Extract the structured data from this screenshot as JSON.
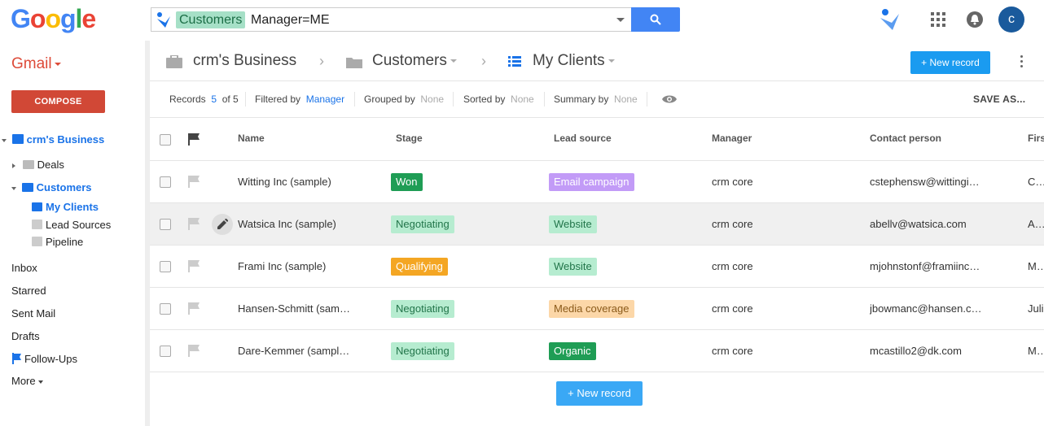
{
  "topbar": {
    "logo": [
      "G",
      "o",
      "o",
      "g",
      "l",
      "e"
    ],
    "logo_colors": [
      "#4285f4",
      "#ea4335",
      "#fbbc05",
      "#4285f4",
      "#34a853",
      "#ea4335"
    ],
    "search_chip": "Customers",
    "search_query": "Manager=ME",
    "avatar_letter": "c"
  },
  "leftnav": {
    "gmail": "Gmail",
    "compose": "COMPOSE",
    "business": "crm's Business",
    "deals": "Deals",
    "customers": "Customers",
    "my_clients": "My Clients",
    "lead_sources": "Lead Sources",
    "pipeline": "Pipeline",
    "inbox": "Inbox",
    "starred": "Starred",
    "sent": "Sent Mail",
    "drafts": "Drafts",
    "followups": "Follow-Ups",
    "more": "More"
  },
  "breadcrumb": {
    "business": "crm's Business",
    "customers": "Customers",
    "my_clients": "My Clients",
    "new_record": "+ New record"
  },
  "toolbar": {
    "records_label": "Records",
    "records_count": "5",
    "records_of": "of 5",
    "filtered_label": "Filtered by",
    "filtered_value": "Manager",
    "grouped_label": "Grouped by",
    "grouped_value": "None",
    "sorted_label": "Sorted by",
    "sorted_value": "None",
    "summary_label": "Summary by",
    "summary_value": "None",
    "save_as": "SAVE AS..."
  },
  "table": {
    "headers": {
      "name": "Name",
      "stage": "Stage",
      "lead_source": "Lead source",
      "manager": "Manager",
      "contact": "Contact person",
      "first": "Firs"
    },
    "rows": [
      {
        "name": "Witting Inc (sample)",
        "stage": "Won",
        "lead": "Email campaign",
        "manager": "crm core",
        "contact": "cstephensw@wittingi…",
        "first": "Chr"
      },
      {
        "name": "Watsica Inc (sample)",
        "stage": "Negotiating",
        "lead": "Website",
        "manager": "crm core",
        "contact": "abellv@watsica.com",
        "first": "Ada"
      },
      {
        "name": "Frami Inc (sample)",
        "stage": "Qualifying",
        "lead": "Website",
        "manager": "crm core",
        "contact": "mjohnstonf@framiinc…",
        "first": "Mic"
      },
      {
        "name": "Hansen-Schmitt (sam…",
        "stage": "Negotiating",
        "lead": "Media coverage",
        "manager": "crm core",
        "contact": "jbowmanc@hansen.c…",
        "first": "Juli"
      },
      {
        "name": "Dare-Kemmer (sampl…",
        "stage": "Negotiating",
        "lead": "Organic",
        "manager": "crm core",
        "contact": "mcastillo2@dk.com",
        "first": "Mar"
      }
    ],
    "new_record": "+ New record"
  },
  "colors": {
    "won": "#1f9d55",
    "negotiating_bg": "#b6ecd0",
    "negotiating_fg": "#22754a",
    "qualifying": "#f4a623",
    "email_campaign": "#c29bf7",
    "website_bg": "#b6ecd0",
    "media_bg": "#fcd7a8",
    "organic": "#1f9d55",
    "accent": "#1a9bf0"
  }
}
